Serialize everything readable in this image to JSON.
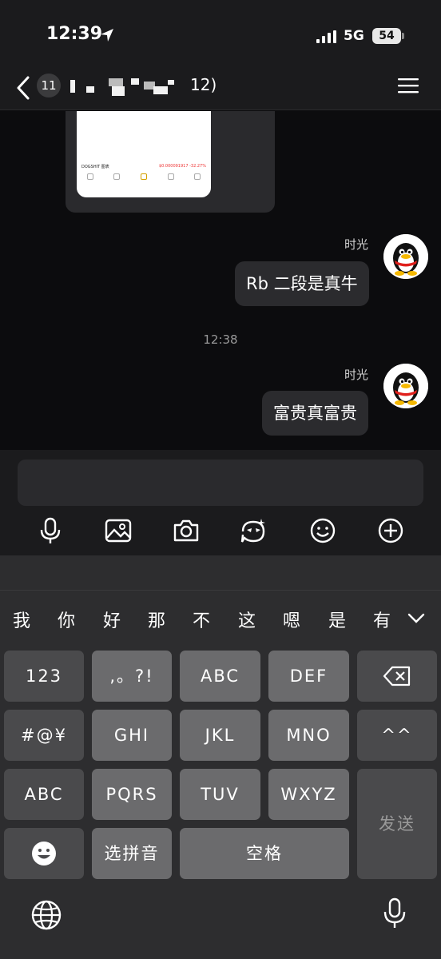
{
  "status_bar": {
    "time": "12:39",
    "network": "5G",
    "battery": "54"
  },
  "nav": {
    "unread_count": "11",
    "title_suffix": "12)"
  },
  "chat": {
    "shared_screenshot": {
      "title": "DOGSHIT 图表",
      "price": "$0.000091917 -32.27%"
    },
    "messages": [
      {
        "sender": "时光",
        "text": "Rb 二段是真牛"
      },
      {
        "sender": "时光",
        "text": "富贵真富贵"
      }
    ],
    "time_divider": "12:38"
  },
  "input": {
    "tools": [
      "microphone-icon",
      "image-icon",
      "camera-icon",
      "sticker-icon",
      "emoji-icon",
      "plus-icon"
    ]
  },
  "keyboard": {
    "candidates": [
      "我",
      "你",
      "好",
      "那",
      "不",
      "这",
      "嗯",
      "是",
      "有"
    ],
    "rows": {
      "r1": [
        "123",
        ",。?!",
        "ABC",
        "DEF"
      ],
      "r2": [
        "#@¥",
        "GHI",
        "JKL",
        "MNO",
        "^^"
      ],
      "r3": [
        "ABC",
        "PQRS",
        "TUV",
        "WXYZ"
      ],
      "r4_choose": "选拼音",
      "r4_space": "空格"
    },
    "send_label": "发送"
  },
  "colors": {
    "background": "#0c0c0e",
    "bubble": "#2b2b2e",
    "key": "#6b6b6d",
    "key_dark": "#4a4a4c"
  }
}
